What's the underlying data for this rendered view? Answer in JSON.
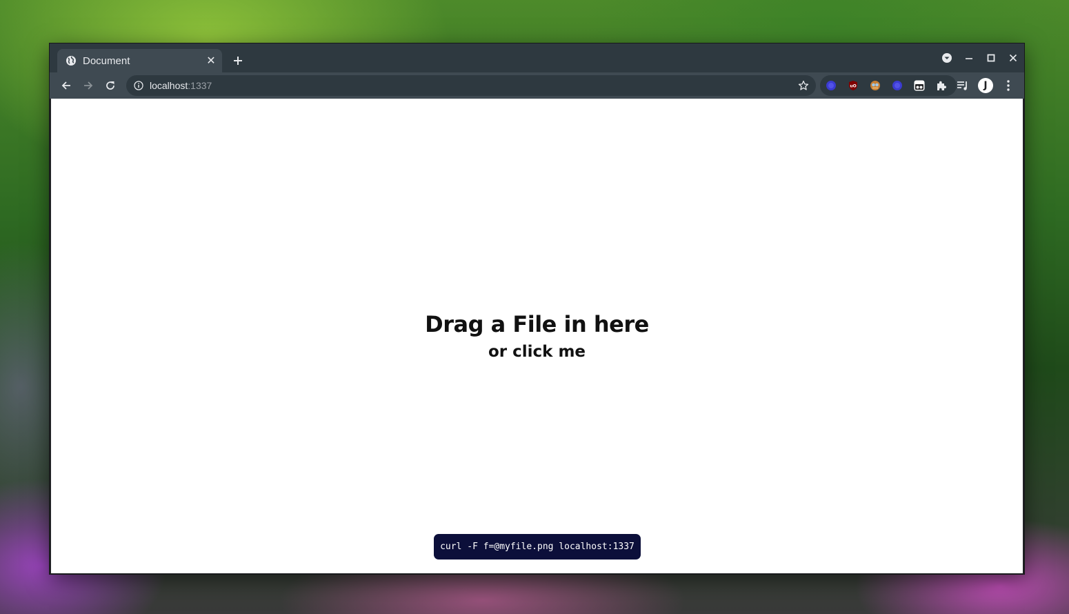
{
  "tab": {
    "title": "Document",
    "close_glyph": "✕",
    "favicon": "globe-icon"
  },
  "toolbar": {
    "url_host": "localhost",
    "url_port": ":1337"
  },
  "extensions": [
    {
      "name": "blue-ghost-extension",
      "color": "#3b3bd1"
    },
    {
      "name": "ublock-origin-extension",
      "color": "#800000"
    },
    {
      "name": "owl-face-extension",
      "color": "#c77f34"
    },
    {
      "name": "blue-ghost-extension-2",
      "color": "#3b3bd1"
    },
    {
      "name": "tampermonkey-extension",
      "color": "#ffffff"
    },
    {
      "name": "puzzle-extensions-icon",
      "color": "#e8eaed"
    },
    {
      "name": "media-playlist-icon",
      "color": "#e8eaed"
    }
  ],
  "profile": {
    "initial": "J"
  },
  "page": {
    "title": "Drag a File in here",
    "subtitle": "or click me",
    "curl_command": "curl -F f=@myfile.png localhost:1337"
  }
}
